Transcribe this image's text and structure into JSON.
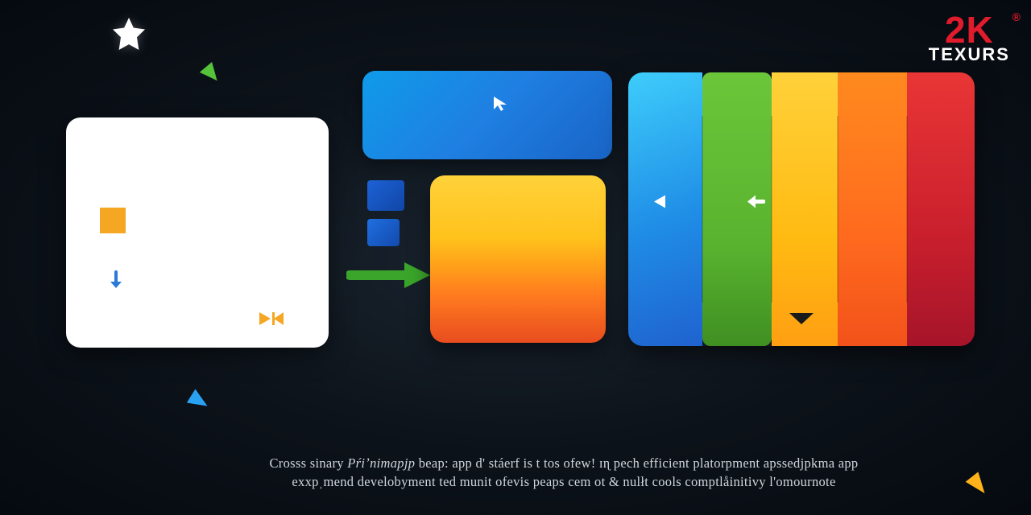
{
  "logo": {
    "top": "2K",
    "bottom": "TEXURS",
    "registered": "®"
  },
  "caption": {
    "line1_pre": "Crosss sinary ",
    "line1_em": "Pŕiʼnimapjp",
    "line1_post": " beap: app d' stáerf is t tos ofew! ɪɳ pech efficient platorpment apssedjpkma app",
    "line2": "exxpˌmend develobyment ted munit ofevis peaps cem ot & nulłt cools comptlåinitivy l'omournote"
  },
  "icons": {
    "star": "star-icon",
    "cursor": "cursor-icon",
    "play_left": "play-left-icon",
    "back_arrow": "back-arrow-icon",
    "chevron_down": "chevron-down-icon",
    "arrow_down": "arrow-down-icon",
    "green_right_arrow": "green-right-arrow-icon"
  },
  "colors": {
    "bg": "#0d131a",
    "accent_red": "#e01b2c",
    "blue": "#1f7fe2",
    "green": "#58b22e",
    "yellow": "#ffc21c",
    "orange": "#ff7a1f",
    "deep_red": "#c91f2d"
  }
}
